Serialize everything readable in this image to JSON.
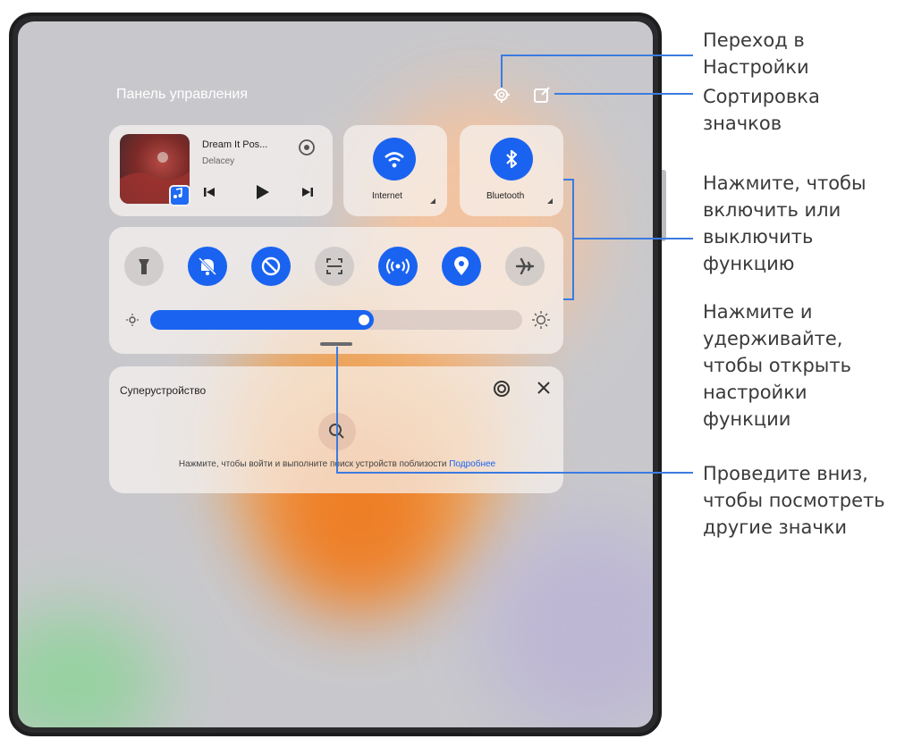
{
  "panel": {
    "title": "Панель управления",
    "settings_icon": "gear-icon",
    "sort_icon": "edit-square-icon"
  },
  "media": {
    "title": "Dream It Pos...",
    "artist": "Delacey",
    "icons": [
      "music-app-icon",
      "previous-icon",
      "play-icon",
      "next-icon",
      "cast-icon"
    ]
  },
  "tiles": [
    {
      "label": "Internet",
      "icon": "wifi-icon"
    },
    {
      "label": "Bluetooth",
      "icon": "bluetooth-icon"
    }
  ],
  "toggles": [
    {
      "icon": "flashlight-icon",
      "on": false
    },
    {
      "icon": "mute-bell-icon",
      "on": true
    },
    {
      "icon": "auto-rotate-icon",
      "on": true
    },
    {
      "icon": "scanner-icon",
      "on": false
    },
    {
      "icon": "nfc-icon",
      "on": true
    },
    {
      "icon": "location-icon",
      "on": true
    },
    {
      "icon": "airplane-icon",
      "on": false
    }
  ],
  "brightness": {
    "level": 0.6
  },
  "superdevice": {
    "title": "Суперустройство",
    "hint": "Нажмите, чтобы войти и выполните поиск устройств поблизости",
    "link": "Подробнее"
  },
  "callouts": {
    "settings_line1": "Переход в",
    "settings_line2": "Настройки",
    "sort_line1": "Сортировка",
    "sort_line2": "значков",
    "toggle_line1": "Нажмите, чтобы",
    "toggle_line2": "включить или",
    "toggle_line3": "выключить",
    "toggle_line4": "функцию",
    "hold_line1": "Нажмите и",
    "hold_line2": "удерживайте,",
    "hold_line3": "чтобы открыть",
    "hold_line4": "настройки",
    "hold_line5": "функции",
    "swipe_line1": "Проведите вниз,",
    "swipe_line2": "чтобы посмотреть",
    "swipe_line3": "другие значки"
  },
  "colors": {
    "accent": "#1a63f0",
    "callout_line": "#3b7be0"
  }
}
